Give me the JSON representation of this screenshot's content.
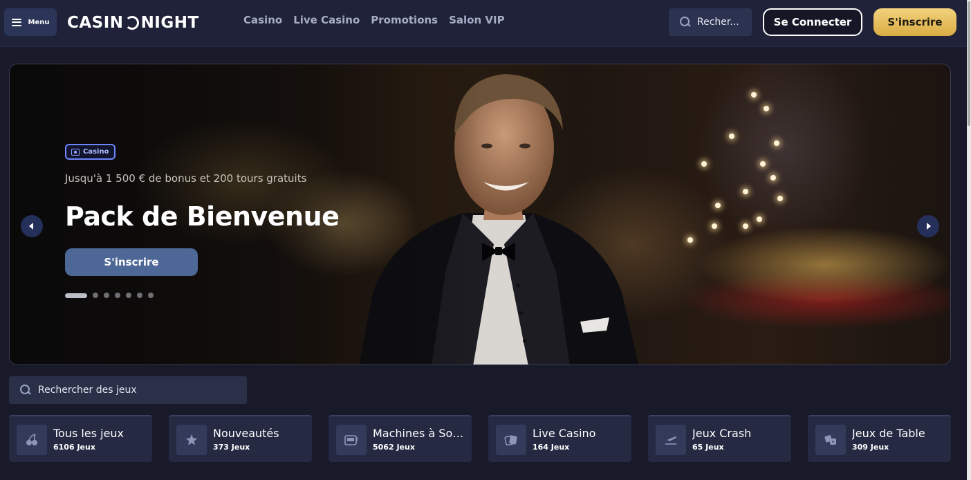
{
  "header": {
    "menu_label": "Menu",
    "logo_left": "CASIN",
    "logo_right": "NIGHT",
    "nav": [
      "Casino",
      "Live Casino",
      "Promotions",
      "Salon VIP"
    ],
    "search_placeholder": "Recher...",
    "login_label": "Se Connecter",
    "signup_label": "S'inscrire"
  },
  "hero": {
    "badge": "Casino",
    "subtitle": "Jusqu'à 1 500 € de bonus et 200 tours gratuits",
    "title": "Pack de Bienvenue",
    "cta": "S'inscrire",
    "slides_total": 7,
    "active_slide": 1
  },
  "game_search": {
    "placeholder": "Rechercher des jeux"
  },
  "categories": [
    {
      "name": "Tous les jeux",
      "count": "6106 Jeux",
      "icon": "cherries-icon"
    },
    {
      "name": "Nouveautés",
      "count": "373 Jeux",
      "icon": "star-icon"
    },
    {
      "name": "Machines à Sous",
      "count": "5062 Jeux",
      "icon": "slot-machine-icon"
    },
    {
      "name": "Live Casino",
      "count": "164 Jeux",
      "icon": "live-cards-icon"
    },
    {
      "name": "Jeux Crash",
      "count": "65 Jeux",
      "icon": "plane-icon"
    },
    {
      "name": "Jeux de Table",
      "count": "309 Jeux",
      "icon": "dice-icon"
    }
  ],
  "colors": {
    "background": "#181a2a",
    "header": "#1f2238",
    "accent_gold": "#e6bd5c",
    "cta_blue": "#4d6796"
  }
}
